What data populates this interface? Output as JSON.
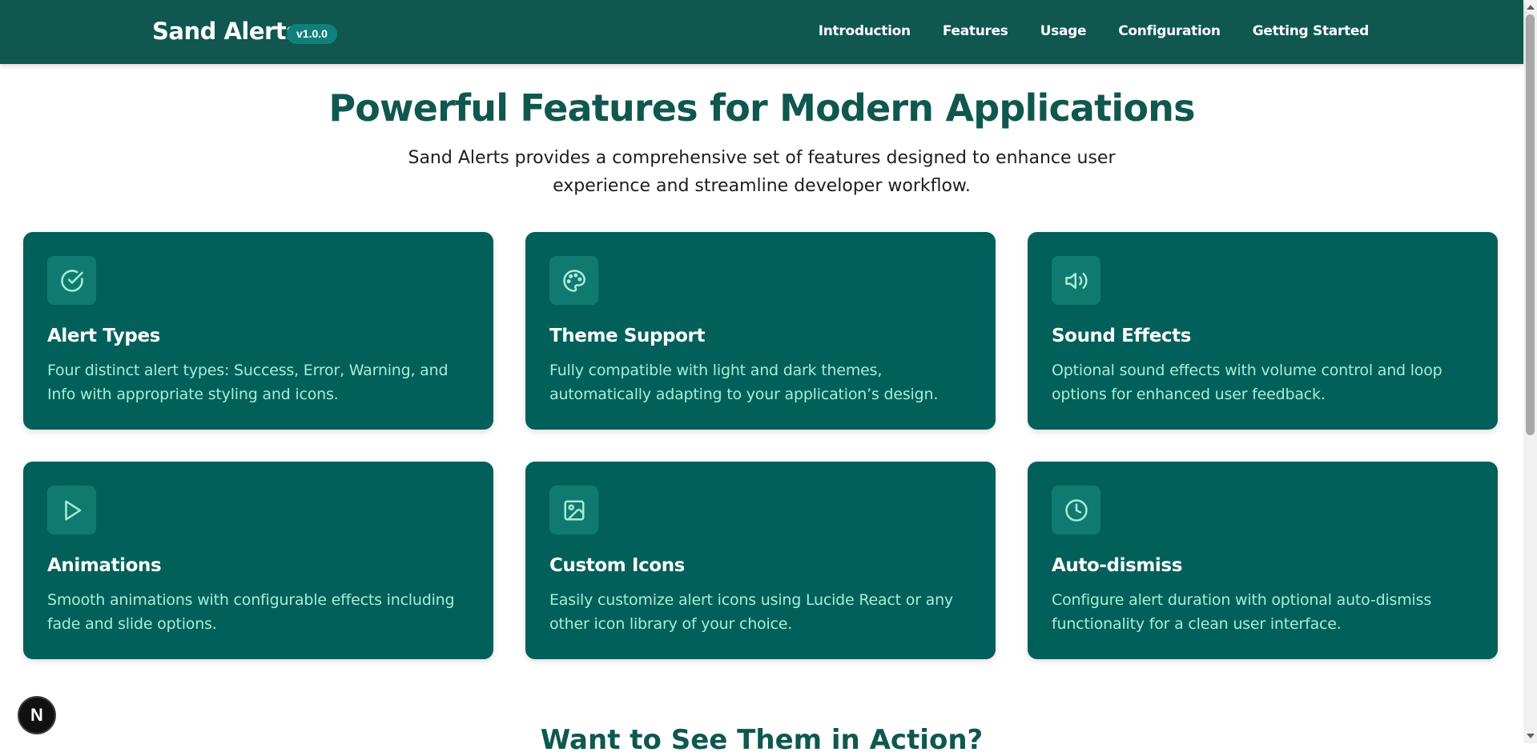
{
  "header": {
    "brand": "Sand Alerts",
    "version": "v1.0.0",
    "nav": [
      "Introduction",
      "Features",
      "Usage",
      "Configuration",
      "Getting Started"
    ]
  },
  "hero": {
    "title": "Powerful Features for Modern Applications",
    "subtitle": "Sand Alerts provides a comprehensive set of features designed to enhance user experience and streamline developer workflow."
  },
  "features": [
    {
      "icon": "check-circle-icon",
      "title": "Alert Types",
      "description": "Four distinct alert types: Success, Error, Warning, and Info with appropriate styling and icons."
    },
    {
      "icon": "palette-icon",
      "title": "Theme Support",
      "description": "Fully compatible with light and dark themes, automatically adapting to your application’s design."
    },
    {
      "icon": "volume-icon",
      "title": "Sound Effects",
      "description": "Optional sound effects with volume control and loop options for enhanced user feedback."
    },
    {
      "icon": "play-icon",
      "title": "Animations",
      "description": "Smooth animations with configurable effects including fade and slide options."
    },
    {
      "icon": "image-icon",
      "title": "Custom Icons",
      "description": "Easily customize alert icons using Lucide React or any other icon library of your choice."
    },
    {
      "icon": "clock-icon",
      "title": "Auto-dismiss",
      "description": "Configure alert duration with optional auto-dismiss functionality for a clean user interface."
    }
  ],
  "next_section": {
    "title": "Want to See Them in Action?"
  },
  "dev_badge": {
    "label": "N"
  },
  "colors": {
    "header_bg": "#0f574f",
    "card_bg": "#02605b",
    "icon_bg": "#117a70",
    "accent_text": "#a8ecd8",
    "title_text": "#0f574f"
  }
}
